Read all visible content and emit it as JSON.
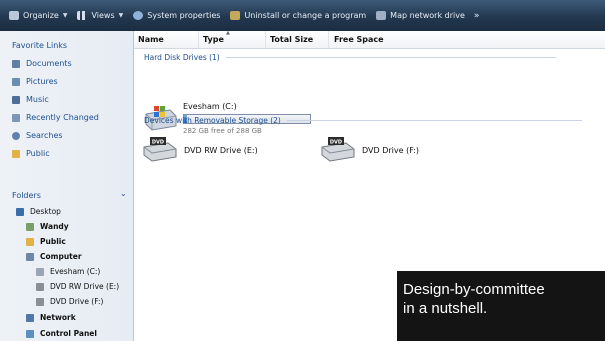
{
  "toolbar": {
    "organize": "Organize",
    "views": "Views",
    "system_properties": "System properties",
    "uninstall": "Uninstall or change a program",
    "map_drive": "Map network drive",
    "more": "»"
  },
  "sidebar": {
    "favorites_title": "Favorite Links",
    "favorites": [
      "Documents",
      "Pictures",
      "Music",
      "Recently Changed",
      "Searches",
      "Public"
    ],
    "folders_title": "Folders",
    "folders_chevron": "⌄",
    "tree": [
      "Desktop",
      "Wandy",
      "Public",
      "Computer",
      "Evesham (C:)",
      "DVD RW Drive (E:)",
      "DVD Drive (F:)",
      "Network",
      "Control Panel"
    ]
  },
  "columns": [
    "Name",
    "Type",
    "Total Size",
    "Free Space"
  ],
  "groups": {
    "hdd": "Hard Disk Drives (1)",
    "removable": "Devices with Removable Storage (2)"
  },
  "drive_c": {
    "name": "Evesham (C:)",
    "free_text": "282 GB free of 288 GB",
    "used_fraction": 0.021
  },
  "removable": [
    {
      "name": "DVD RW Drive (E:)",
      "badge": "DVD"
    },
    {
      "name": "DVD Drive (F:)",
      "badge": "DVD"
    }
  ],
  "caption": {
    "line1": "Design-by-committee",
    "line2": "in a nutshell."
  }
}
